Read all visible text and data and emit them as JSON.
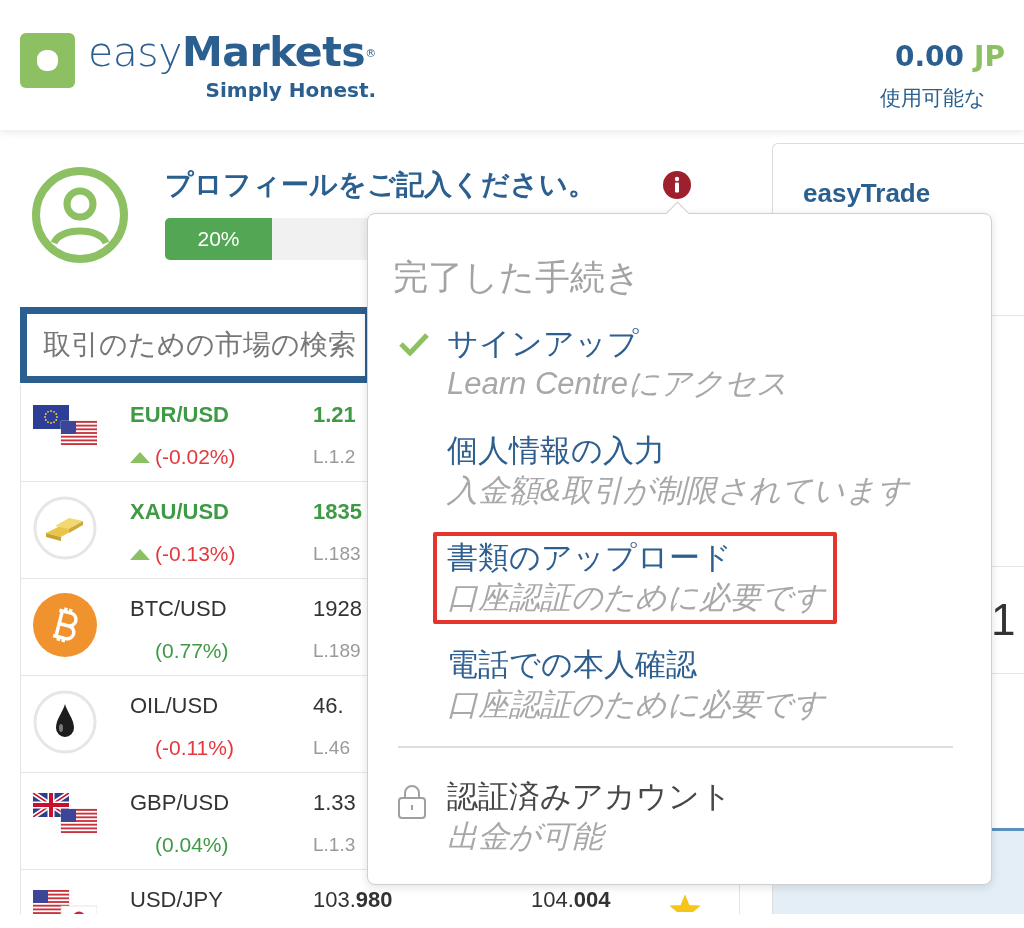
{
  "header": {
    "logo_text": "easy**Markets**$^{®}$",
    "tagline": "Simply Honest.",
    "balance": {
      "amount": "0.00",
      "currency": "JP",
      "label": "使用可能な"
    }
  },
  "profile": {
    "title": "プロフィールをご記入ください。",
    "progress": {
      "level": 0.2,
      "label": "20%"
    }
  },
  "markets": {
    "search": {
      "placeholder": "取引のための市場の検索"
    },
    "rows": [
      {
        "kind": "eurusd",
        "symbol": "EUR/USD",
        "tick_up": true,
        "change": "(-0.02%)",
        "negative": true,
        "price": "1.21",
        "low": "L.1.2"
      },
      {
        "kind": "gold",
        "symbol": "XAU/USD",
        "tick_up": true,
        "change": "(-0.13%)",
        "negative": true,
        "price": "1835",
        "low": "L.183"
      },
      {
        "kind": "bitcoin",
        "symbol": "BTC/USD",
        "tick_up": false,
        "change": "(0.77%)",
        "negative": false,
        "price": "1928",
        "low": "L.189"
      },
      {
        "kind": "oil",
        "symbol": "OIL/USD",
        "tick_up": false,
        "change": "(-0.11%)",
        "negative": true,
        "price": "46.",
        "low": "L.46"
      },
      {
        "kind": "gbpusd",
        "symbol": "GBP/USD",
        "tick_up": false,
        "change": "(0.04%)",
        "negative": false,
        "price": "1.33",
        "low": "L.1.3"
      },
      {
        "kind": "usdjpy",
        "symbol": "USD/JPY",
        "tick_up": false,
        "price": "103.**980**",
        "ask": "104.**004**",
        "starred": true
      }
    ]
  },
  "trade_panel": {
    "tab": "easyTrade",
    "number": "1"
  },
  "steps_popup": {
    "heading": "完了した手続き",
    "steps": [
      {
        "kind": "done",
        "title": "サインアップ",
        "subtitle": "Learn Centreにアクセス",
        "highlighted": false
      },
      {
        "kind": "todo",
        "title": "個人情報の入力",
        "subtitle": "入金額&取引が制限されています",
        "highlighted": false
      },
      {
        "kind": "todo",
        "title": "書類のアップロード",
        "subtitle": "口座認証のために必要です",
        "highlighted": true
      },
      {
        "kind": "todo",
        "title": "電話での本人確認",
        "subtitle": "口座認証のために必要です",
        "highlighted": false
      },
      {
        "kind": "locked",
        "title": "認証済みアカウント",
        "subtitle": "出金が可能",
        "highlighted": false
      }
    ]
  }
}
